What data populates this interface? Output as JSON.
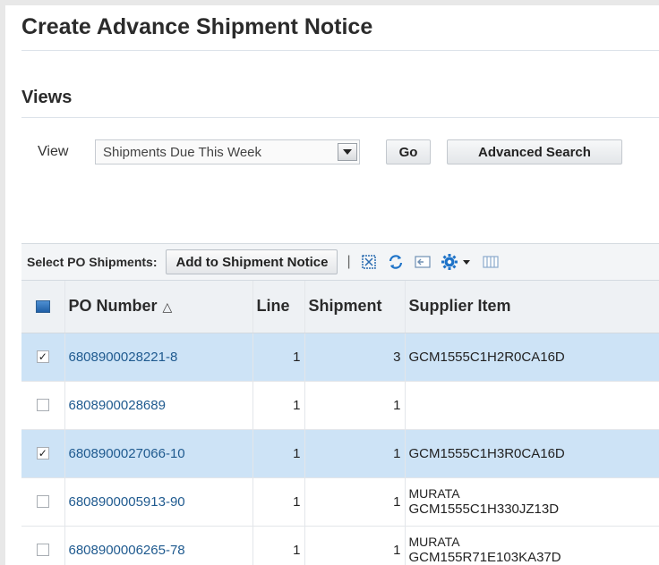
{
  "page": {
    "title": "Create Advance Shipment Notice"
  },
  "views": {
    "header": "Views",
    "view_label": "View",
    "selected_view": "Shipments Due This Week",
    "go_label": "Go",
    "advanced_search_label": "Advanced Search"
  },
  "toolbar": {
    "label": "Select PO Shipments:",
    "add_button": "Add to Shipment Notice",
    "separator": "|"
  },
  "table": {
    "headers": {
      "po_number": "PO Number",
      "line": "Line",
      "shipment": "Shipment",
      "supplier_item": "Supplier Item"
    },
    "rows": [
      {
        "po_number": "6808900028221-8",
        "line": "1",
        "shipment": "3",
        "supplier_item_line1": "GCM1555C1H2R0CA16D",
        "supplier_item_line2": "",
        "checked": true
      },
      {
        "po_number": "6808900028689",
        "line": "1",
        "shipment": "1",
        "supplier_item_line1": "",
        "supplier_item_line2": "",
        "checked": false
      },
      {
        "po_number": "6808900027066-10",
        "line": "1",
        "shipment": "1",
        "supplier_item_line1": "GCM1555C1H3R0CA16D",
        "supplier_item_line2": "",
        "checked": true
      },
      {
        "po_number": "6808900005913-90",
        "line": "1",
        "shipment": "1",
        "supplier_item_line1": "MURATA",
        "supplier_item_line2": "GCM1555C1H330JZ13D",
        "checked": false
      },
      {
        "po_number": "6808900006265-78",
        "line": "1",
        "shipment": "1",
        "supplier_item_line1": "MURATA",
        "supplier_item_line2": "GCM155R71E103KA37D",
        "checked": false
      }
    ]
  },
  "icons": {
    "toolbar": [
      "detach-icon",
      "refresh-icon",
      "freeze-icon",
      "settings-icon",
      "columns-icon"
    ]
  },
  "colors": {
    "link": "#1f5a8f",
    "selected_row": "#cde3f6",
    "header_bg": "#eef1f4"
  }
}
